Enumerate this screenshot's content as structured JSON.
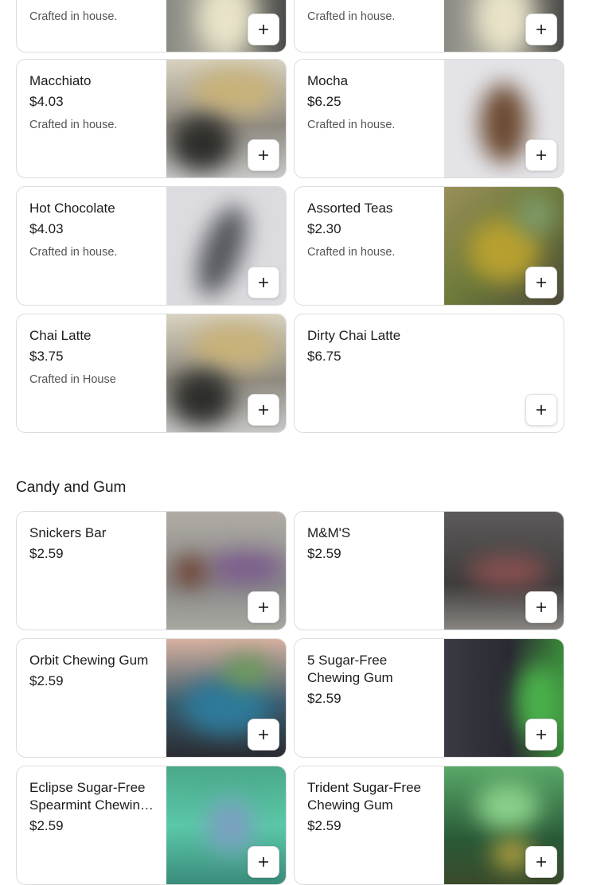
{
  "top_partial": [
    {
      "desc": "Crafted in house."
    },
    {
      "desc": "Crafted in house."
    }
  ],
  "coffee_items": [
    {
      "name": "Macchiato",
      "price": "$4.03",
      "desc": "Crafted in house."
    },
    {
      "name": "Mocha",
      "price": "$6.25",
      "desc": "Crafted in house."
    },
    {
      "name": "Hot Chocolate",
      "price": "$4.03",
      "desc": "Crafted in house."
    },
    {
      "name": "Assorted Teas",
      "price": "$2.30",
      "desc": "Crafted in house."
    },
    {
      "name": "Chai Latte",
      "price": "$3.75",
      "desc": "Crafted in House"
    },
    {
      "name": "Dirty Chai Latte",
      "price": "$6.75"
    }
  ],
  "candy_section": {
    "title": "Candy and Gum",
    "items": [
      {
        "name": "Snickers Bar",
        "price": "$2.59"
      },
      {
        "name": "M&M'S",
        "price": "$2.59"
      },
      {
        "name": "Orbit Chewing Gum",
        "price": "$2.59"
      },
      {
        "name": "5 Sugar-Free Chewing Gum",
        "price": "$2.59"
      },
      {
        "name": "Eclipse Sugar-Free Spearmint Chewing Gum",
        "price": "$2.59"
      },
      {
        "name": "Trident Sugar-Free Chewing Gum",
        "price": "$2.59"
      }
    ]
  },
  "icons": {
    "add": "plus-icon"
  }
}
